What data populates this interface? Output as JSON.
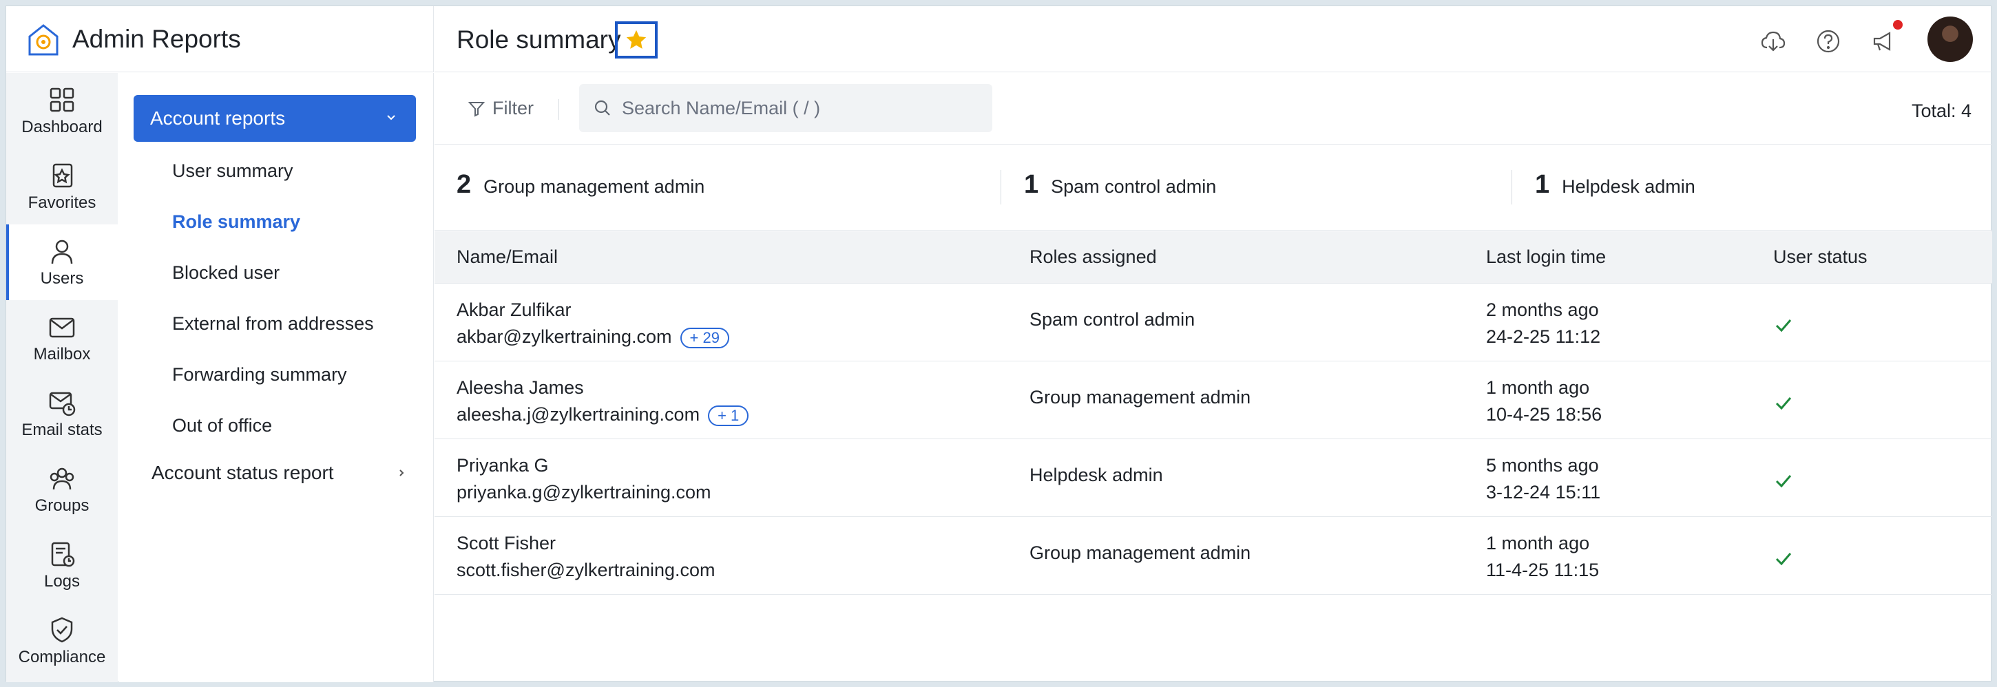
{
  "app": {
    "title": "Admin Reports"
  },
  "rail": {
    "items": [
      {
        "label": "Dashboard",
        "icon": "dashboard-icon"
      },
      {
        "label": "Favorites",
        "icon": "favorites-icon"
      },
      {
        "label": "Users",
        "icon": "users-icon",
        "active": true
      },
      {
        "label": "Mailbox",
        "icon": "mailbox-icon"
      },
      {
        "label": "Email stats",
        "icon": "email-stats-icon"
      },
      {
        "label": "Groups",
        "icon": "groups-icon"
      },
      {
        "label": "Logs",
        "icon": "logs-icon"
      },
      {
        "label": "Compliance",
        "icon": "compliance-icon"
      }
    ]
  },
  "submenu": {
    "section": "Account reports",
    "items": [
      {
        "label": "User summary"
      },
      {
        "label": "Role summary",
        "active": true
      },
      {
        "label": "Blocked user"
      },
      {
        "label": "External from addresses"
      },
      {
        "label": "Forwarding summary"
      },
      {
        "label": "Out of office"
      }
    ],
    "status_report": "Account status report"
  },
  "header": {
    "title": "Role summary"
  },
  "toolbar": {
    "filter_label": "Filter",
    "search_placeholder": "Search Name/Email ( / )",
    "total": "Total: 4"
  },
  "summary": [
    {
      "count": "2",
      "label": "Group management admin"
    },
    {
      "count": "1",
      "label": "Spam control admin"
    },
    {
      "count": "1",
      "label": "Helpdesk admin"
    }
  ],
  "table": {
    "columns": [
      "Name/Email",
      "Roles assigned",
      "Last login time",
      "User status"
    ],
    "rows": [
      {
        "name": "Akbar Zulfikar",
        "email": "akbar@zylkertraining.com",
        "badge": "+ 29",
        "role": "Spam control admin",
        "login_relative": "2 months ago",
        "login_time": "24-2-25 11:12"
      },
      {
        "name": "Aleesha James",
        "email": "aleesha.j@zylkertraining.com",
        "badge": "+ 1",
        "role": "Group management admin",
        "login_relative": "1 month ago",
        "login_time": "10-4-25 18:56"
      },
      {
        "name": "Priyanka G",
        "email": "priyanka.g@zylkertraining.com",
        "badge": "",
        "role": "Helpdesk admin",
        "login_relative": "5 months ago",
        "login_time": "3-12-24 15:11"
      },
      {
        "name": "Scott Fisher",
        "email": "scott.fisher@zylkertraining.com",
        "badge": "",
        "role": "Group management admin",
        "login_relative": "1 month ago",
        "login_time": "11-4-25 11:15"
      }
    ]
  },
  "colors": {
    "accent": "#2a68d8",
    "check": "#1e8a3c",
    "star": "#f5b400"
  }
}
